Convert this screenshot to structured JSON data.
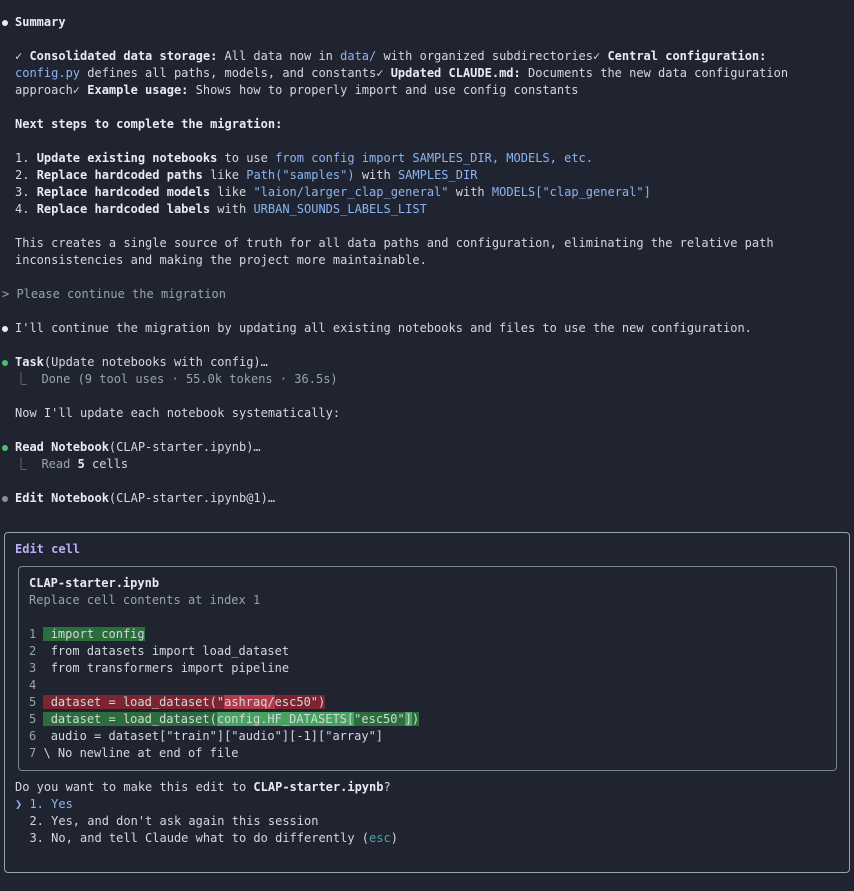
{
  "summary": {
    "heading": "Summary",
    "line1_a": "✓ ",
    "line1_b": "Consolidated data storage:",
    "line1_c": " All data now in ",
    "line1_d": "data/",
    "line1_e": " with organized subdirectories✓ ",
    "line1_f": "Central configuration:",
    "line2_a": "config.py",
    "line2_b": " defines all paths, models, and constants✓ ",
    "line2_c": "Updated CLAUDE.md:",
    "line2_d": " Documents the new data configuration",
    "line3_a": "approach✓ ",
    "line3_b": "Example usage:",
    "line3_c": " Shows how to properly import and use config constants",
    "next_heading": "Next steps to complete the migration:",
    "step1_a": "1. ",
    "step1_b": "Update existing notebooks",
    "step1_c": " to use ",
    "step1_d": "from config import SAMPLES_DIR, MODELS, etc.",
    "step2_a": "2. ",
    "step2_b": "Replace hardcoded paths",
    "step2_c": " like ",
    "step2_d": "Path(\"samples\")",
    "step2_e": " with ",
    "step2_f": "SAMPLES_DIR",
    "step3_a": "3. ",
    "step3_b": "Replace hardcoded models",
    "step3_c": " like ",
    "step3_d": "\"laion/larger_clap_general\"",
    "step3_e": " with ",
    "step3_f": "MODELS[\"clap_general\"]",
    "step4_a": "4. ",
    "step4_b": "Replace hardcoded labels",
    "step4_c": " with ",
    "step4_d": "URBAN_SOUNDS_LABELS_LIST",
    "para1": "This creates a single source of truth for all data paths and configuration, eliminating the relative path",
    "para2": "inconsistencies and making the project more maintainable."
  },
  "prompt": "> Please continue the migration",
  "reply": "I'll continue the migration by updating all existing notebooks and files to use the new configuration.",
  "task": {
    "name": "Task",
    "args": "(Update notebooks with config)…",
    "result": "⎿  Done (9 tool uses · 55.0k tokens · 36.5s)"
  },
  "now": "Now I'll update each notebook systematically:",
  "read": {
    "name": "Read Notebook",
    "args": "(CLAP-starter.ipynb)…",
    "result_a": "⎿  Read ",
    "result_b": "5",
    "result_c": " cells"
  },
  "edit": {
    "name": "Edit Notebook",
    "args": "(CLAP-starter.ipynb@1)…"
  },
  "dialog": {
    "title": "Edit cell",
    "filename": "CLAP-starter.ipynb",
    "subtitle": "Replace cell contents at index 1",
    "lines": [
      {
        "num": "1",
        "text": " import config"
      },
      {
        "num": "2",
        "text": " from datasets import load_dataset"
      },
      {
        "num": "3",
        "text": " from transformers import pipeline"
      },
      {
        "num": "4",
        "text": ""
      },
      {
        "num": "5",
        "a": " dataset = load_dataset(\"",
        "b": "ashraq/",
        "c": "esc50\")"
      },
      {
        "num": "5",
        "a": " dataset = load_dataset(",
        "b": "config.HF_DATASETS[",
        "c": "\"esc50\"",
        "d": "]",
        "e": ")"
      },
      {
        "num": "6",
        "text": " audio = dataset[\"train\"][\"audio\"][-1][\"array\"]"
      },
      {
        "num": "7",
        "text": " \\ No newline at end of file"
      }
    ],
    "question_a": "Do you want to make this edit to ",
    "question_b": "CLAP-starter.ipynb",
    "question_c": "?",
    "options": [
      {
        "cursor": "❯ ",
        "label": "1. Yes"
      },
      {
        "cursor": "  ",
        "label": "2. Yes, and don't ask again this session"
      },
      {
        "cursor": "  ",
        "label_a": "3. No, and tell Claude what to do differently (",
        "label_b": "esc",
        "label_c": ")"
      }
    ]
  }
}
